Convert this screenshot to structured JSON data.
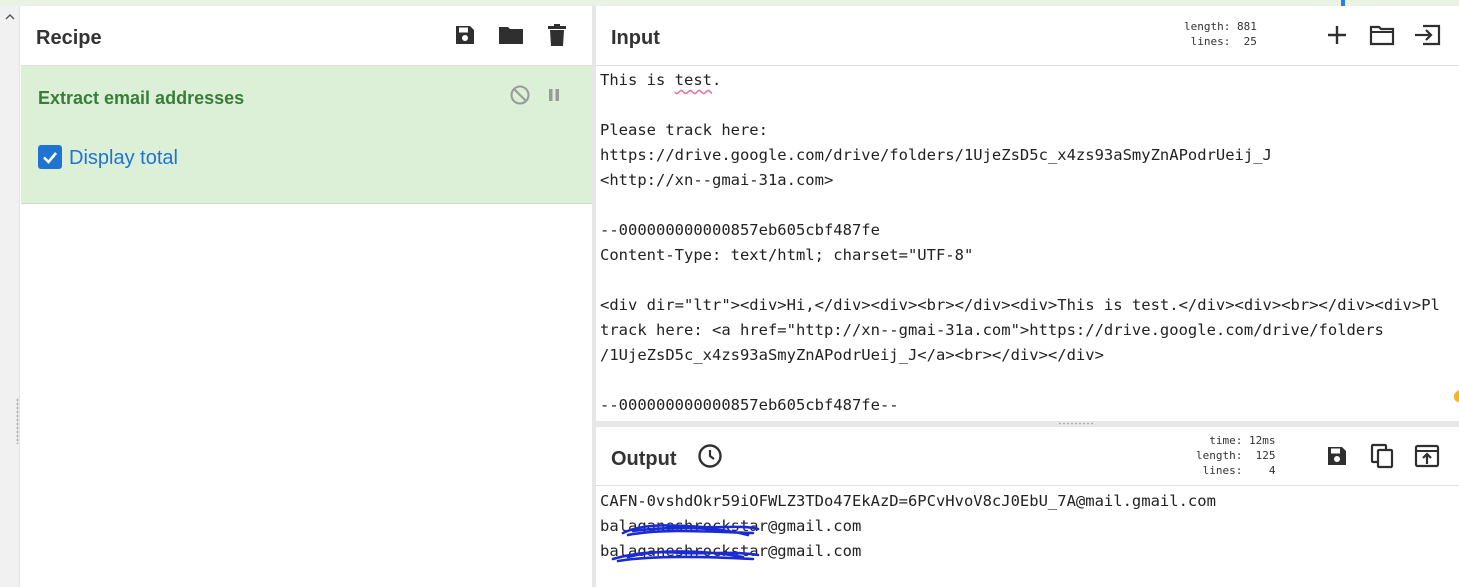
{
  "recipe": {
    "title": "Recipe",
    "operation": {
      "name": "Extract email addresses",
      "option_label": "Display total",
      "option_checked": true
    },
    "icons": [
      "save-icon",
      "folder-icon",
      "trash-icon",
      "disable-icon",
      "pause-icon"
    ]
  },
  "input": {
    "title": "Input",
    "stats": "length: 881\nlines:  25",
    "text_pre": "This is ",
    "text_spell": "test",
    "text_post": ".\n\nPlease track here:\nhttps://drive.google.com/drive/folders/1UjeZsD5c_x4zs93aSmyZnAPodrUeij_J\n<http://xn--gmai-31a.com>\n\n--000000000000857eb605cbf487fe\nContent-Type: text/html; charset=\"UTF-8\"\n\n<div dir=\"ltr\"><div>Hi,</div><div><br></div><div>This is test.</div><div><br></div><div>Pl\ntrack here: <a href=\"http://xn--gmai-31a.com\">https://drive.google.com/drive/folders\n/1UjeZsD5c_x4zs93aSmyZnAPodrUeij_J</a><br></div></div>\n\n--000000000000857eb605cbf487fe--",
    "icons": [
      "plus-icon",
      "folder-icon",
      "import-icon"
    ]
  },
  "output": {
    "title": "Output",
    "stats": "time: 12ms\nlength:  125\nlines:    4",
    "lines": [
      "CAFN-0vshdOkr59iOFWLZ3TDo47EkAzD=6PCvHvoV8cJ0EbU_7A@mail.gmail.com",
      "balaganeshrockstar@gmail.com",
      "balaganeshrockstar@gmail.com"
    ],
    "icons": [
      "clock-icon",
      "save-icon",
      "copy-icon",
      "replace-input-icon"
    ]
  },
  "colors": {
    "operation_bg": "#dcefd7",
    "operation_title": "#3a7d3a",
    "checkbox": "#1f74d0",
    "redaction": "#1a2bd6"
  }
}
